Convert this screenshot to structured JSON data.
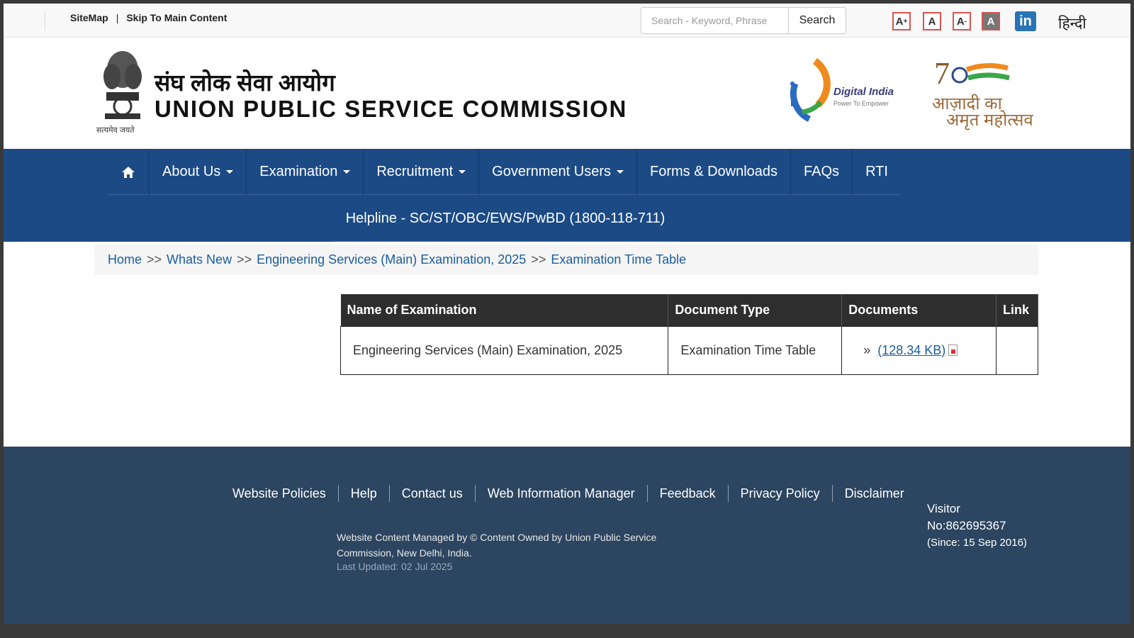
{
  "topbar": {
    "sitemap": "SiteMap",
    "separator": "|",
    "skip": "Skip To Main Content",
    "search_placeholder": "Search - Keyword, Phrase",
    "search_button": "Search",
    "font_increase": "A",
    "font_normal": "A",
    "font_decrease": "A",
    "contrast": "A",
    "linkedin": "in",
    "language": "हिन्दी"
  },
  "header": {
    "title_hindi": "संघ लोक सेवा आयोग",
    "title_english": "UNION PUBLIC SERVICE COMMISSION",
    "emblem_caption": "सत्यमेव जयते",
    "digital_india": "Digital India",
    "digital_india_tagline": "Power To Empower",
    "azadi_line1": "आज़ादी का",
    "azadi_line2": "अमृत महोत्सव"
  },
  "nav": {
    "items": [
      {
        "label": "About Us"
      },
      {
        "label": "Examination"
      },
      {
        "label": "Recruitment"
      },
      {
        "label": "Government Users"
      },
      {
        "label": "Forms & Downloads"
      },
      {
        "label": "FAQs"
      },
      {
        "label": "RTI"
      }
    ],
    "helpline": "Helpline - SC/ST/OBC/EWS/PwBD (1800-118-711)"
  },
  "breadcrumb": {
    "items": [
      "Home",
      "Whats New",
      "Engineering Services (Main) Examination, 2025",
      "Examination Time Table"
    ],
    "separator": ">>"
  },
  "table": {
    "headers": [
      "Name of Examination",
      "Document Type",
      "Documents",
      "Link"
    ],
    "rows": [
      {
        "name": "Engineering Services (Main) Examination, 2025",
        "type": "Examination Time Table",
        "doc_prefix": "»",
        "doc_link": "(128.34 KB)",
        "link": ""
      }
    ]
  },
  "footer": {
    "links": [
      "Website Policies",
      "Help",
      "Contact us",
      "Web Information Manager",
      "Feedback",
      "Privacy Policy",
      "Disclaimer"
    ],
    "copyright": "Website Content Managed by © Content Owned by Union Public Service Commission, New Delhi, India.",
    "last_updated": "Last Updated: 02 Jul 2025",
    "visitor_label": "Visitor",
    "visitor_no": "No:862695367",
    "visitor_since": "(Since: 15 Sep 2016)"
  },
  "colors": {
    "nav_bg": "#1b4a85",
    "footer_bg": "#2c4560",
    "link": "#1a5d9c",
    "table_header": "#2e2e2e"
  }
}
